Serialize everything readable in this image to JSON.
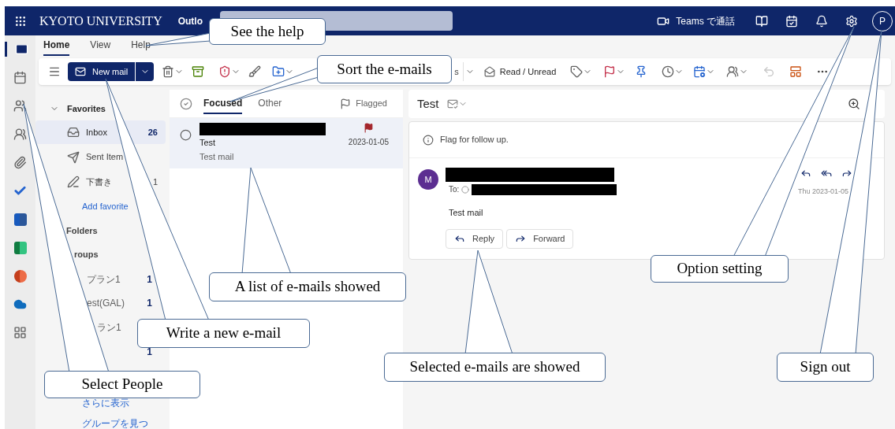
{
  "top_bar": {
    "brand": "KYOTO UNIVERSITY",
    "app": "Outlo",
    "call_button": "Teams で通話",
    "avatar": "P"
  },
  "app_rail": [
    {
      "kind": "mail",
      "selected": true
    },
    {
      "kind": "calendar",
      "selected": false
    },
    {
      "kind": "people",
      "selected": false
    },
    {
      "kind": "groups",
      "selected": false
    },
    {
      "kind": "files",
      "selected": false
    },
    {
      "kind": "todo",
      "selected": false
    },
    {
      "kind": "word",
      "selected": false
    },
    {
      "kind": "excel",
      "selected": false
    },
    {
      "kind": "powerpoint",
      "selected": false
    },
    {
      "kind": "onedrive",
      "selected": false
    },
    {
      "kind": "apps",
      "selected": false
    }
  ],
  "ribbon_tabs": [
    {
      "label": "Home",
      "selected": true
    },
    {
      "label": "View",
      "selected": false
    },
    {
      "label": "Help",
      "selected": false
    }
  ],
  "toolbar": {
    "new_mail": "New mail",
    "partial_label": "s",
    "read_unread": "Read / Unread"
  },
  "folders": {
    "favorites_heading": "Favorites",
    "favorites": [
      {
        "kind": "inbox",
        "name": "Inbox",
        "count": "26",
        "selected": true
      },
      {
        "kind": "sent",
        "name": "Sent Item",
        "selected": false
      },
      {
        "kind": "drafts",
        "name": "下書き",
        "count": "1",
        "selected": false
      }
    ],
    "add_favorite": "Add favorite",
    "folders_heading": "Folders",
    "groups_heading": "roups",
    "groups": [
      {
        "name": "プラン1",
        "count": "1"
      },
      {
        "name": "est(GAL)",
        "count": "1"
      },
      {
        "name": "ラン1"
      },
      {
        "count": "1"
      }
    ],
    "show_more": "さらに表示",
    "discover_groups": "グループを見つ"
  },
  "message_list": {
    "tabs": [
      {
        "label": "Focused",
        "selected": true
      },
      {
        "label": "Other",
        "selected": false
      }
    ],
    "filter": "Flagged",
    "messages": [
      {
        "subject": "Test",
        "preview": "Test mail",
        "date": "2023-01-05",
        "flagged": true,
        "selected": true
      }
    ]
  },
  "reading_pane": {
    "subject": "Test",
    "info": "Flag for follow up.",
    "sender_initial": "M",
    "to_label": "To:",
    "date": "Thu 2023-01-05",
    "body": "Test mail",
    "actions": [
      "Reply",
      "Forward"
    ]
  },
  "callouts": [
    "See the help",
    "Sort the e-mails",
    "A list of e-mails showed",
    "Write a new e-mail",
    "Select People",
    "Selected e-mails are showed",
    "Option setting",
    "Sign out"
  ]
}
